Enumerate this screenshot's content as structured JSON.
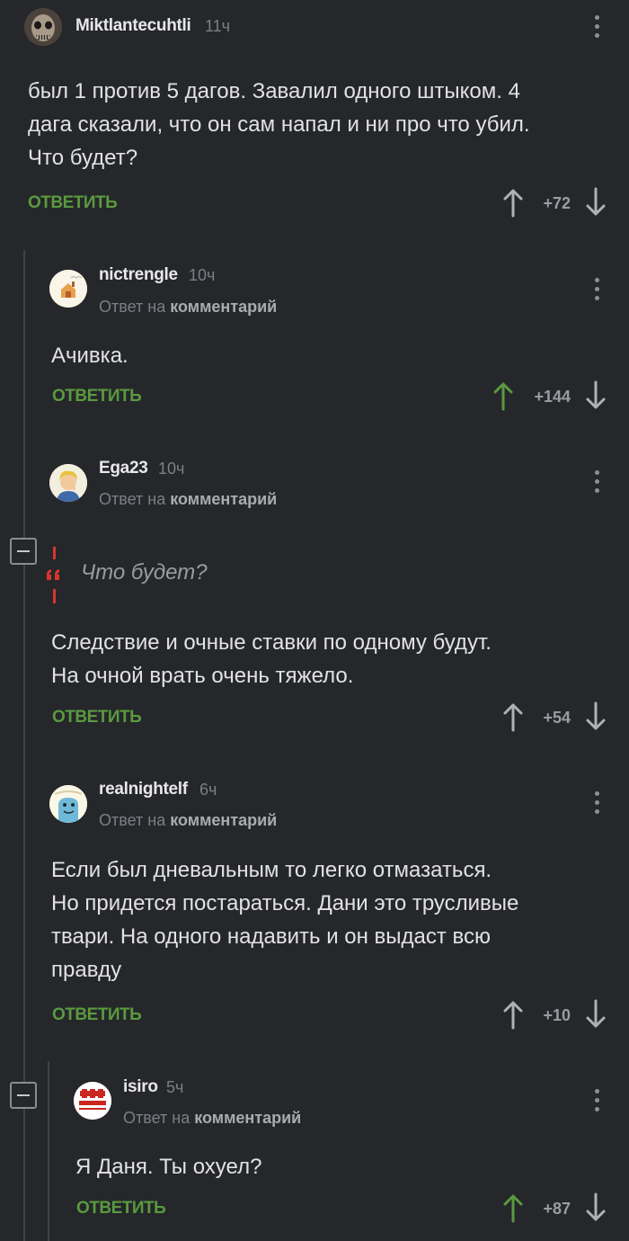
{
  "labels": {
    "reply": "ОТВЕТИТЬ",
    "reply_prefix": "Ответ на",
    "reply_target": "комментарий"
  },
  "comments": [
    {
      "username": "Miktlantecuhtli",
      "time": "11ч",
      "lines": [
        "был 1 против 5 дагов. Завалил одного штыком. 4",
        "дага сказали, что он сам напал и ни про что убил.",
        "Что будет?"
      ],
      "score": "+72",
      "upvoted": false
    },
    {
      "username": "nictrengle",
      "time": "10ч",
      "lines": [
        "Ачивка."
      ],
      "score": "+144",
      "upvoted": true
    },
    {
      "username": "Ega23",
      "time": "10ч",
      "quote": "Что будет?",
      "lines": [
        "Следствие и очные ставки по одному будут.",
        "На очной врать очень тяжело."
      ],
      "score": "+54",
      "upvoted": false
    },
    {
      "username": "realnightelf",
      "time": "6ч",
      "lines": [
        "Если был дневальным то легко отмазаться.",
        "Но придется постараться. Дани это трусливые",
        "твари. На одного надавить и он выдаст всю",
        "правду"
      ],
      "score": "+10",
      "upvoted": false
    },
    {
      "username": "isiro",
      "time": "5ч",
      "lines": [
        "Я Даня. Ты охуел?"
      ],
      "score": "+87",
      "upvoted": true
    }
  ],
  "colors": {
    "background": "#25272b",
    "reply_green": "#5a9a3f",
    "quote_red": "#d9352b",
    "text": "#e2e2e2",
    "muted": "#7c7f84"
  }
}
